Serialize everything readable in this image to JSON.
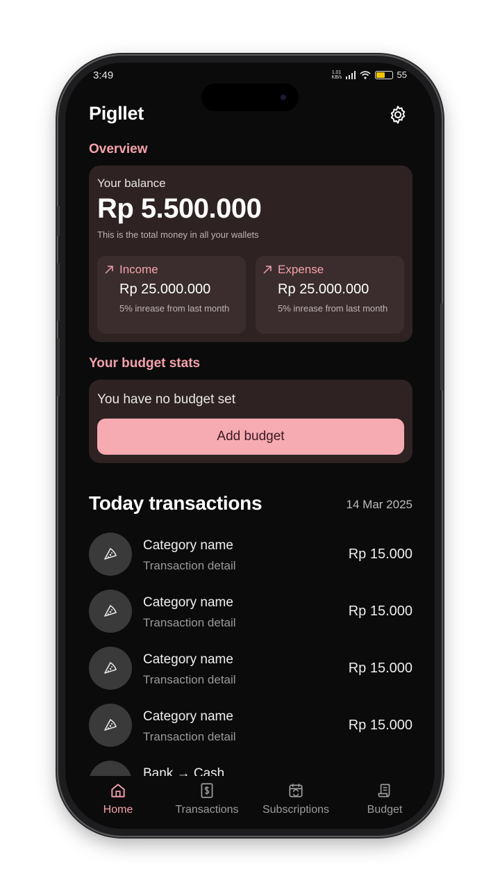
{
  "status_bar": {
    "time": "3:49",
    "net_speed": "1.01 KB/s",
    "battery": "55"
  },
  "header": {
    "title": "Pigllet",
    "settings_icon": "gear-icon"
  },
  "overview": {
    "section_label": "Overview",
    "balance_label": "Your balance",
    "balance_value": "Rp 5.500.000",
    "balance_note": "This is the total money in all your wallets",
    "income": {
      "label": "Income",
      "value": "Rp 25.000.000",
      "note": "5% inrease from last month",
      "icon": "arrow-up-right-icon"
    },
    "expense": {
      "label": "Expense",
      "value": "Rp 25.000.000",
      "note": "5% inrease from last month",
      "icon": "arrow-up-right-icon"
    }
  },
  "budget": {
    "section_label": "Your budget stats",
    "empty_text": "You have no budget set",
    "add_button_label": "Add budget"
  },
  "transactions": {
    "title": "Today transactions",
    "date": "14 Mar 2025",
    "items": [
      {
        "category": "Category name",
        "detail": "Transaction detail",
        "amount": "Rp 15.000",
        "icon": "pizza-icon"
      },
      {
        "category": "Category name",
        "detail": "Transaction detail",
        "amount": "Rp 15.000",
        "icon": "pizza-icon"
      },
      {
        "category": "Category name",
        "detail": "Transaction detail",
        "amount": "Rp 15.000",
        "icon": "pizza-icon"
      },
      {
        "category": "Category name",
        "detail": "Transaction detail",
        "amount": "Rp 15.000",
        "icon": "pizza-icon"
      },
      {
        "category": "Bank → Cash",
        "detail": "",
        "amount": "",
        "icon": "transfer-icon"
      }
    ]
  },
  "bottom_nav": {
    "items": [
      {
        "label": "Home",
        "icon": "home-icon",
        "active": true
      },
      {
        "label": "Transactions",
        "icon": "receipt-dollar-icon",
        "active": false
      },
      {
        "label": "Subscriptions",
        "icon": "calendar-repeat-icon",
        "active": false
      },
      {
        "label": "Budget",
        "icon": "scroll-icon",
        "active": false
      }
    ]
  },
  "colors": {
    "accent": "#f4a2ac",
    "button": "#f6aab2",
    "card": "#2e2222",
    "background": "#0b0b0b"
  }
}
